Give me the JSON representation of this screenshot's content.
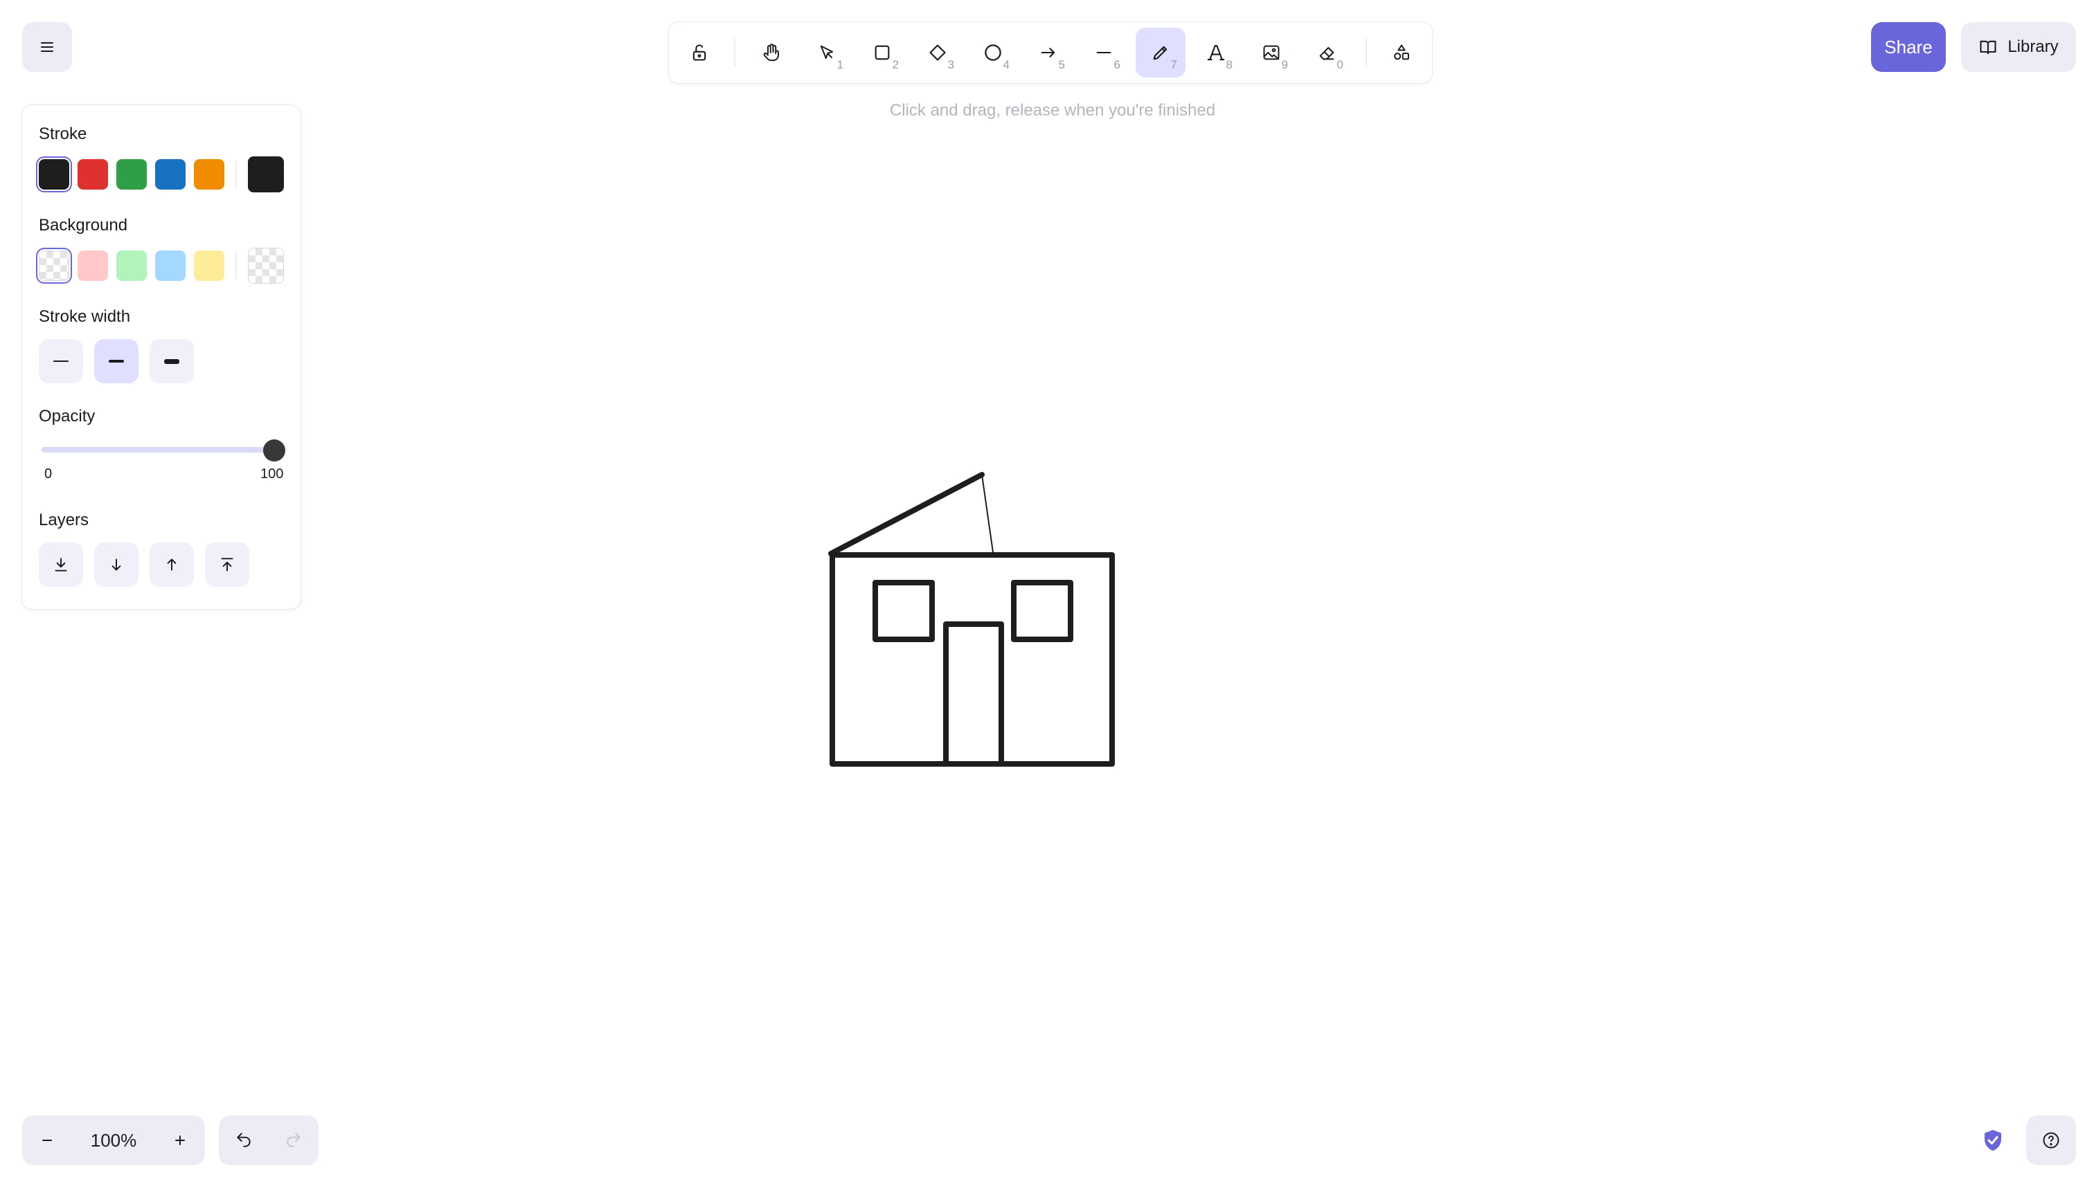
{
  "app": {
    "accent": "#6965db",
    "selected_tool": "freedraw"
  },
  "header": {
    "share_label": "Share",
    "library_label": "Library"
  },
  "toolbar": {
    "hint": "Click and drag, release when you're finished",
    "tools": [
      {
        "name": "lock",
        "icon": "unlocked-icon",
        "key": ""
      },
      {
        "name": "hand",
        "icon": "hand-icon",
        "key": ""
      },
      {
        "name": "selection",
        "icon": "pointer-icon",
        "key": "1"
      },
      {
        "name": "rectangle",
        "icon": "rectangle-icon",
        "key": "2"
      },
      {
        "name": "diamond",
        "icon": "diamond-icon",
        "key": "3"
      },
      {
        "name": "ellipse",
        "icon": "ellipse-icon",
        "key": "4"
      },
      {
        "name": "arrow",
        "icon": "arrow-icon",
        "key": "5"
      },
      {
        "name": "line",
        "icon": "line-icon",
        "key": "6"
      },
      {
        "name": "freedraw",
        "icon": "pencil-icon",
        "key": "7"
      },
      {
        "name": "text",
        "icon": "text-icon",
        "key": "8"
      },
      {
        "name": "image",
        "icon": "image-icon",
        "key": "9"
      },
      {
        "name": "eraser",
        "icon": "eraser-icon",
        "key": "0"
      },
      {
        "name": "more-tools",
        "icon": "shapes-icon",
        "key": ""
      }
    ]
  },
  "properties": {
    "stroke_label": "Stroke",
    "stroke_colors": [
      "#1e1e1e",
      "#e03131",
      "#2f9e44",
      "#1971c2",
      "#f08c00"
    ],
    "stroke_selected": "#1e1e1e",
    "background_label": "Background",
    "background_colors": [
      "transparent",
      "#ffc9c9",
      "#b2f2bb",
      "#a5d8ff",
      "#ffec99"
    ],
    "background_selected": "transparent",
    "stroke_width_label": "Stroke width",
    "stroke_width_options": [
      "thin",
      "bold",
      "extra-bold"
    ],
    "stroke_width_selected": "bold",
    "opacity_label": "Opacity",
    "opacity_min": "0",
    "opacity_max": "100",
    "opacity_value": 100,
    "layers_label": "Layers"
  },
  "footer": {
    "zoom_level": "100%"
  }
}
